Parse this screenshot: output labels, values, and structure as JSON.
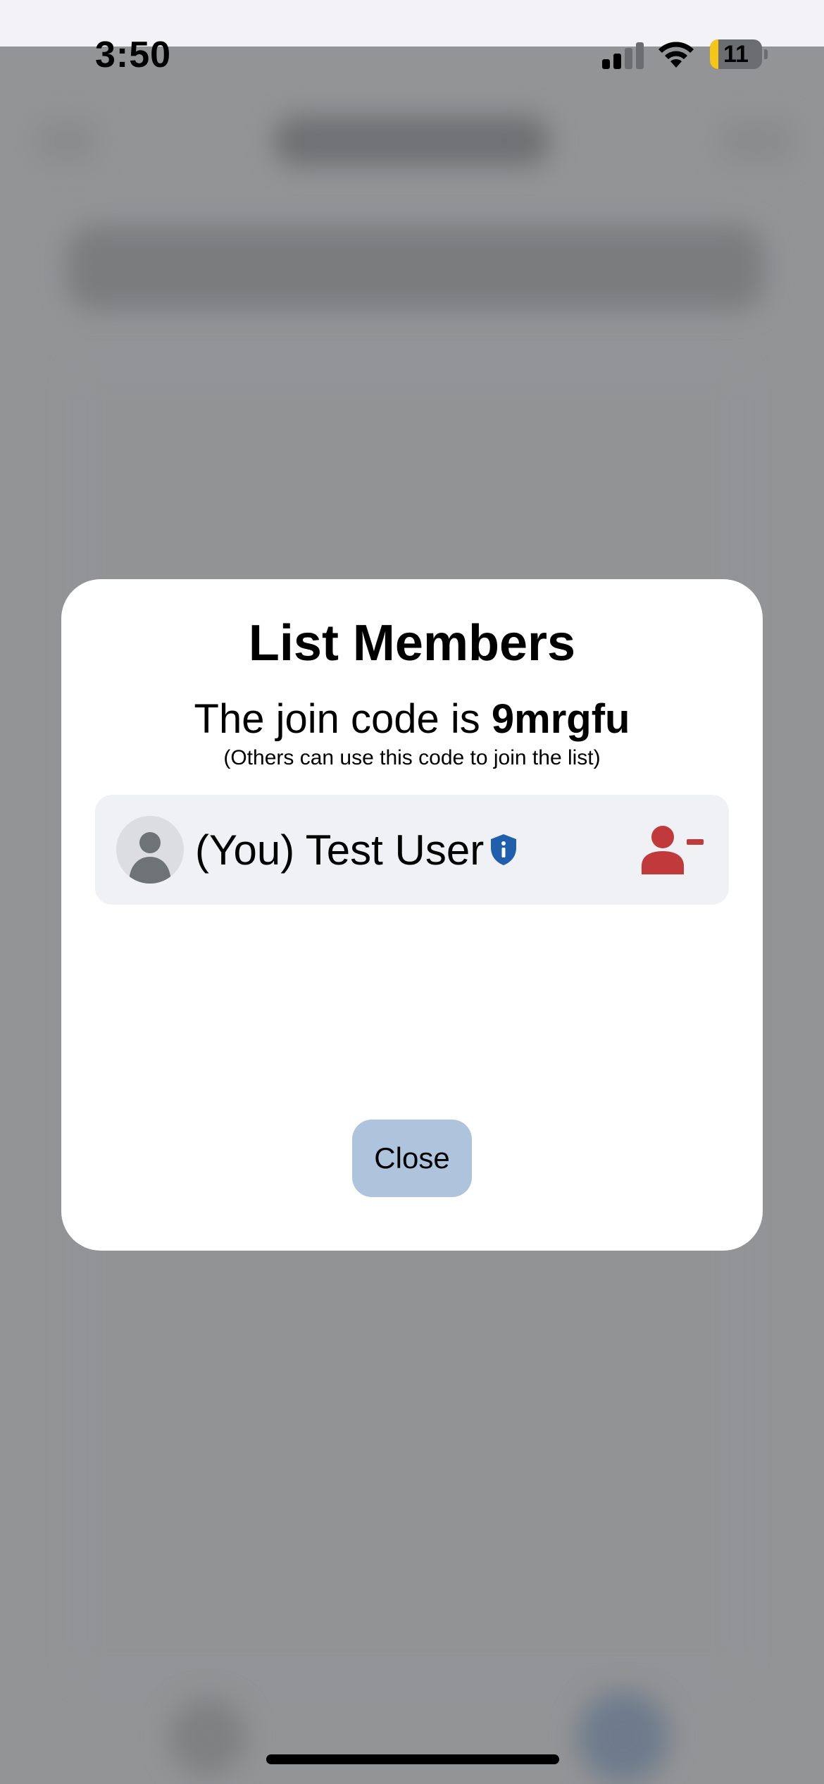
{
  "status_bar": {
    "time": "3:50",
    "battery_level": "11",
    "icons": [
      "signal-icon",
      "wifi-icon",
      "battery-icon"
    ]
  },
  "modal": {
    "title": "List Members",
    "join_prefix": "The join code is ",
    "join_code": "9mrgfu",
    "join_hint": "(Others can use this code to join the list)",
    "members": [
      {
        "name": "(You) Test User",
        "avatar_icon": "person-avatar-icon",
        "badge_icon": "shield-info-icon",
        "action_icon": "remove-member-icon"
      }
    ],
    "close_label": "Close"
  },
  "colors": {
    "overlay": "#8e8f91",
    "modal_bg": "#ffffff",
    "member_row_bg": "#f0f1f4",
    "close_button_bg": "#aec3dc",
    "shield_blue": "#1f5fad",
    "remove_red": "#c0393b",
    "battery_low": "#f5c518"
  }
}
